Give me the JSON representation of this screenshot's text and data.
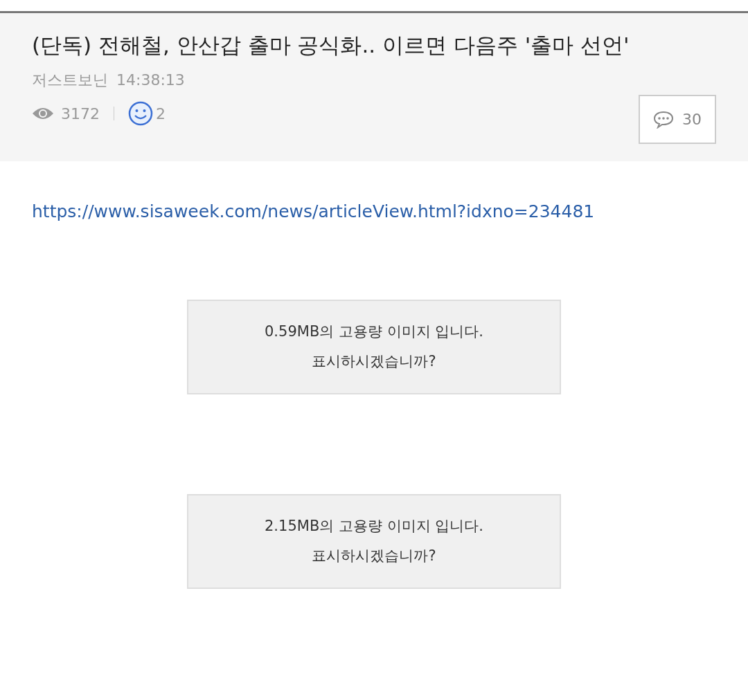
{
  "article": {
    "title": "(단독) 전해철, 안산갑 출마 공식화.. 이르면 다음주 '출마 선언'",
    "author": "저스트보닌",
    "time": "14:38:13",
    "views": "3172",
    "likes": "2",
    "comments": "30"
  },
  "body": {
    "link": "https://www.sisaweek.com/news/articleView.html?idxno=234481",
    "images": [
      {
        "line1": "0.59MB의 고용량 이미지 입니다.",
        "line2": "표시하시겠습니까?"
      },
      {
        "line1": "2.15MB의 고용량 이미지 입니다.",
        "line2": "표시하시겠습니까?"
      }
    ]
  }
}
